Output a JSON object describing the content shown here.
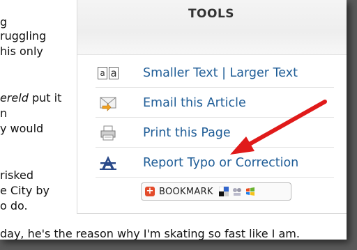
{
  "article": {
    "lines": [
      "g",
      "ruggling",
      "his only",
      "",
      "",
      "",
      "",
      "n",
      "y would",
      "",
      "",
      "risked",
      "e City by",
      "o do."
    ],
    "italic_fragment": "ereld",
    "italic_rest": " put it",
    "bottom_line": "day, he's the reason why I'm skating so fast like I am."
  },
  "tools": {
    "title": "TOOLS",
    "items": [
      {
        "label": "Smaller Text | Larger Text",
        "icon": "text-size-icon"
      },
      {
        "label": "Email this Article",
        "icon": "email-icon"
      },
      {
        "label": "Print this Page",
        "icon": "printer-icon"
      },
      {
        "label": "Report Typo or Correction",
        "icon": "report-typo-icon"
      }
    ],
    "bookmark": {
      "label": "BOOKMARK",
      "plus": "+"
    }
  },
  "colors": {
    "link": "#1f5d97",
    "arrow": "#e01a1a",
    "bookmark_plus": "#e34b2b"
  }
}
